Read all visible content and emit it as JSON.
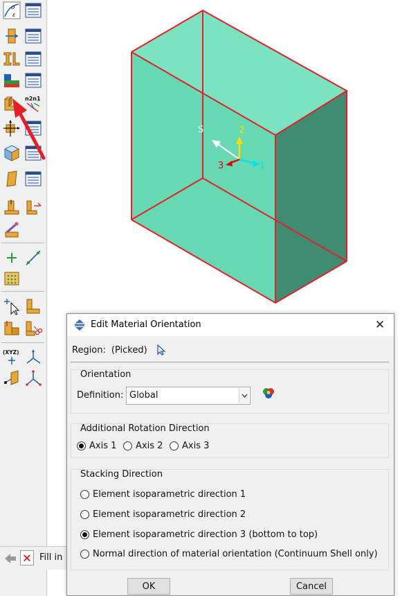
{
  "toolbox": {
    "tools": [
      "create-material-icon",
      "material-manager-icon",
      "create-section-icon",
      "section-manager-icon",
      "create-profile-icon",
      "profile-manager-icon",
      "assign-section-icon",
      "section-assignment-manager-icon",
      "assign-material-orientation-icon",
      "assign-rebar-reference-orientation-icon",
      "assign-beam-orientation-icon",
      "orientation-manager-icon",
      "create-composite-layup-icon",
      "layup-manager-icon",
      "create-skin-icon",
      "skin-manager-icon",
      "special-tool-a-icon",
      "special-tool-b-icon",
      "inertia-tool-icon",
      "create-datum-point-icon",
      "create-datum-axis-icon",
      "create-mesh-icon",
      "query-tool-icon",
      "partition-tool-icon",
      "assembly-tool-icon",
      "cut-tool-icon",
      "datum-csys-icon",
      "datum-axis-tool-icon",
      "datum-plane-icon",
      "datum-triad-icon"
    ]
  },
  "viewport": {
    "triad": {
      "x_label": "1",
      "y_label": "2",
      "z_label": "3",
      "stack_label": "S"
    },
    "colors": {
      "face_front": "#66d8b3",
      "face_side": "#3f8c72",
      "edge": "#e41f26",
      "axis_x": "#00e5e5",
      "axis_y": "#ffe000",
      "axis_z": "#e60000"
    }
  },
  "prompt": {
    "text": "Fill in"
  },
  "dialog": {
    "title": "Edit Material Orientation",
    "region_label": "Region:",
    "region_value": "(Picked)",
    "orientation": {
      "title": "Orientation",
      "definition_label": "Definition:",
      "definition_value": "Global"
    },
    "rotation": {
      "title": "Additional Rotation Direction",
      "options": [
        "Axis 1",
        "Axis 2",
        "Axis 3"
      ],
      "selected": 0
    },
    "stacking": {
      "title": "Stacking Direction",
      "options": [
        "Element isoparametric direction 1",
        "Element isoparametric direction 2",
        "Element isoparametric direction 3 (bottom to top)",
        "Normal direction of material orientation (Continuum Shell only)"
      ],
      "selected": 2
    },
    "ok_label": "OK",
    "cancel_label": "Cancel"
  }
}
